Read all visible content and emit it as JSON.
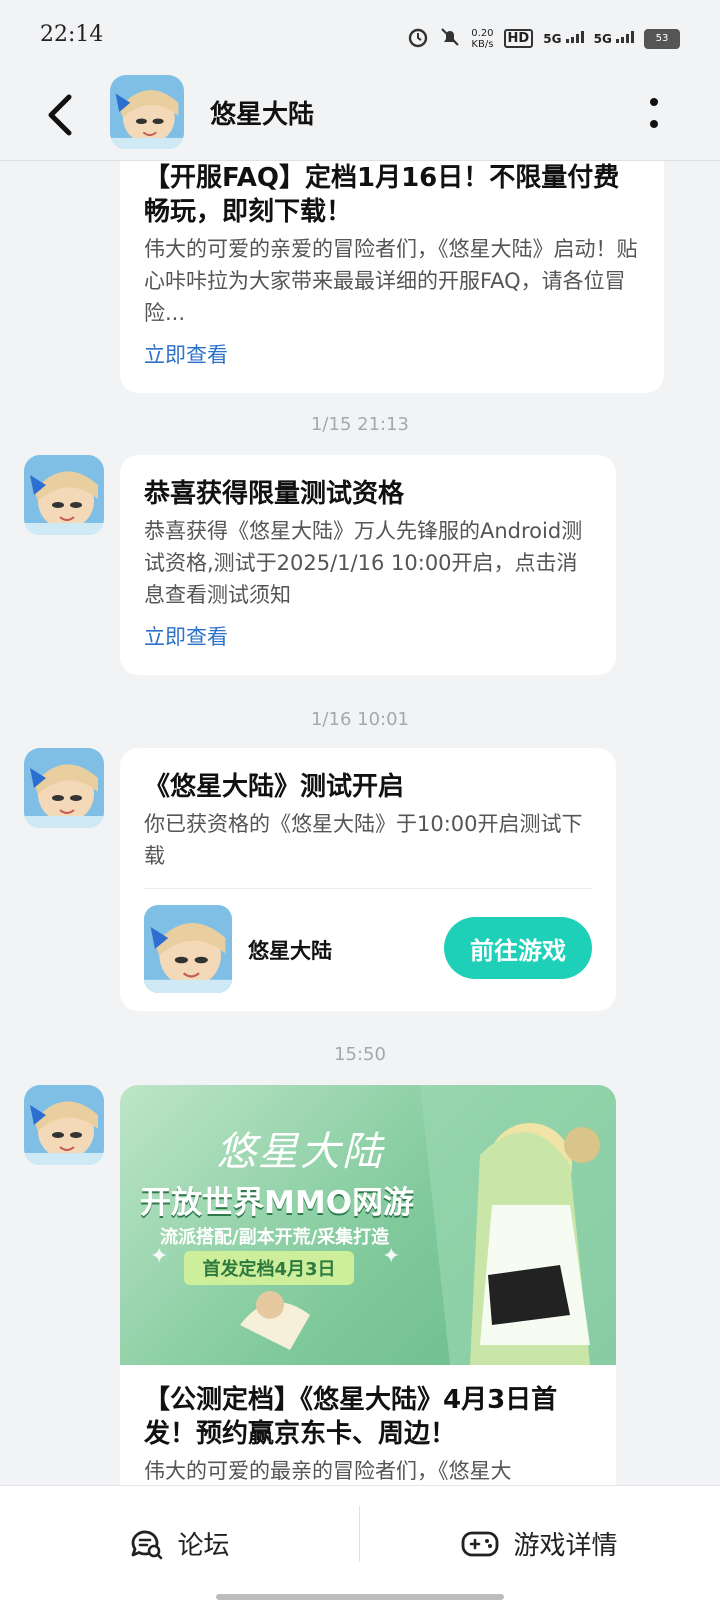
{
  "status_bar": {
    "time": "22:14",
    "speed_value": "0.20",
    "speed_unit": "KB/s",
    "hd": "HD",
    "net1": "5G",
    "net2": "5G",
    "battery": "53"
  },
  "header": {
    "title": "悠星大陆",
    "back_icon": "back-chevron-icon",
    "more_icon": "more-vertical-icon"
  },
  "messages": [
    {
      "title": "【开服FAQ】定档1月16日！不限量付费畅玩，即刻下载！",
      "body": "伟大的可爱的亲爱的冒险者们，《悠星大陆》启动！贴心咔咔拉为大家带来最最详细的开服FAQ，请各位冒险...",
      "link": "立即查看"
    },
    {
      "time": "1/15 21:13",
      "title": "恭喜获得限量测试资格",
      "body": "恭喜获得《悠星大陆》万人先锋服的Android测试资格,测试于2025/1/16 10:00开启，点击消息查看测试须知",
      "link": "立即查看"
    },
    {
      "time": "1/16 10:01",
      "title": "《悠星大陆》测试开启",
      "body": "你已获资格的《悠星大陆》于10:00开启测试下载",
      "game_name": "悠星大陆",
      "button": "前往游戏"
    },
    {
      "time": "15:50",
      "banner": {
        "logo": "悠星大陆",
        "headline": "开放世界MMO网游",
        "sub": "流派搭配/副本开荒/采集打造",
        "badge": "首发定档4月3日"
      },
      "title": "【公测定档】《悠星大陆》4月3日首发！预约赢京东卡、周边！",
      "body": "伟大的可爱的最亲的冒险者们，《悠星大"
    }
  ],
  "bottom_nav": {
    "forum": "论坛",
    "game_detail": "游戏详情"
  }
}
